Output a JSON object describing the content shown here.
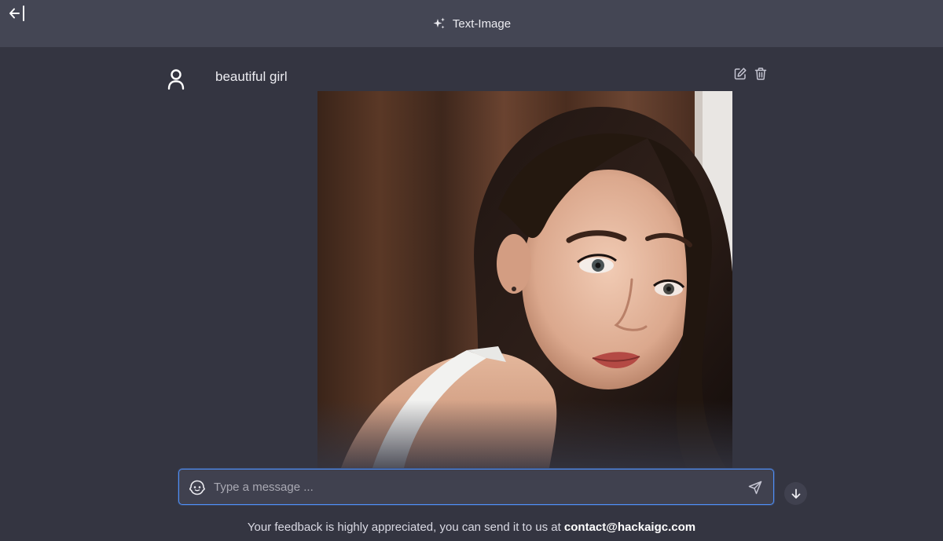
{
  "header": {
    "title": "Text-Image",
    "collapse_icon": "arrow-left-bar-icon",
    "title_icon": "sparkles-icon"
  },
  "message": {
    "avatar_icon": "user-icon",
    "prompt": "beautiful girl",
    "actions": [
      {
        "icon": "edit-icon"
      },
      {
        "icon": "trash-icon"
      }
    ],
    "image_description_icon": "generated-image"
  },
  "composer": {
    "placeholder": "Type a message ...",
    "value": "",
    "left_icon": "bot-face-icon",
    "send_icon": "send-icon"
  },
  "scroll_button": {
    "icon": "arrow-down-icon"
  },
  "footer": {
    "text": "Your feedback is highly appreciated, you can send it to us at",
    "email": "contact@hackaigc.com"
  },
  "colors": {
    "background": "#343541",
    "topbar": "#444654",
    "input_border": "#4f8ff7",
    "text": "#ececf1"
  }
}
